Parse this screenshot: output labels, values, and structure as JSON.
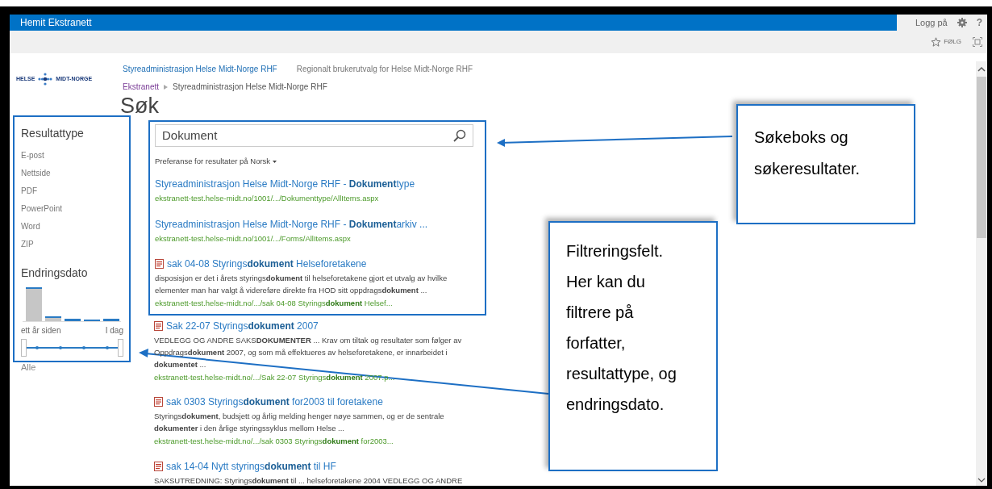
{
  "suite_bar": {
    "title": "Hemit Ekstranett",
    "sign_in": "Logg på",
    "help": "?"
  },
  "ribbon": {
    "follow": "FØLG"
  },
  "header": {
    "logo_left": "HELSE",
    "logo_right": "MIDT-NORGE",
    "top_links": [
      {
        "label": "Styreadministrasjon Helse Midt-Norge RHF",
        "selected": true
      },
      {
        "label": "Regionalt brukerutvalg for Helse Midt-Norge RHF",
        "selected": false
      }
    ],
    "breadcrumb": [
      "Ekstranett",
      "Styreadministrasjon Helse Midt-Norge RHF"
    ],
    "page_title": "Søk"
  },
  "result_type": {
    "title": "Resultattype",
    "items": [
      "E-post",
      "Nettside",
      "PDF",
      "PowerPoint",
      "Word",
      "ZIP"
    ]
  },
  "modified_date": {
    "title": "Endringsdato",
    "from_label": "ett år siden",
    "to_label": "I dag",
    "reset": "Alle"
  },
  "search": {
    "value": "Dokument",
    "language_pref": "Preferanse for resultater på Norsk"
  },
  "results": [
    {
      "kind": "page",
      "title": "Styreadministrasjon Helse Midt-Norge RHF - **Dokument**type",
      "url": "ekstranett-test.helse-midt.no/1001/.../Dokumenttype/AllItems.aspx"
    },
    {
      "kind": "page",
      "title": "Styreadministrasjon Helse Midt-Norge RHF - **Dokument**arkiv ...",
      "url": "ekstranett-test.helse-midt.no/1001/.../Forms/AllItems.aspx"
    },
    {
      "kind": "document",
      "title": "sak 04-08 Styrings**dokument** Helseforetakene",
      "snippet": "disposisjon er det i årets styrings**dokument** til helseforetakene gjort et utvalg av hvilke elementer man har valgt å videreføre direkte fra HOD sitt oppdrags**dokument** ...",
      "url": "ekstranett-test.helse-midt.no/.../sak 04-08 Styrings**dokument** Helsef..."
    },
    {
      "kind": "document",
      "title": "Sak 22-07 Styrings**dokument** 2007",
      "snippet": "VEDLEGG OG ANDRE SAKS**DOKUMENTER** ... Krav om tiltak og resultater som følger av Oppdrags**dokument** 2007, og som må effektueres av helseforetakene, er innarbeidet i **dokumentet** ...",
      "url": "ekstranett-test.helse-midt.no/.../Sak 22-07 Styrings**dokument** 2007.p..."
    },
    {
      "kind": "document",
      "title": "sak 0303 Styrings**dokument** for2003 til foretakene",
      "snippet": "Styrings**dokument**, budsjett og årlig melding henger nøye sammen, og er de sentrale **dokumenter** i den årlige styringssyklus mellom Helse ...",
      "url": "ekstranett-test.helse-midt.no/.../sak 0303 Styrings**dokument** for2003..."
    },
    {
      "kind": "document",
      "title": "sak 14-04 Nytt styrings**dokument** til HF",
      "snippet": "SAKSUTREDNING: Styrings**dokument** til ... helseforetakene 2004 VEDLEGG OG ANDRE"
    }
  ],
  "callouts": [
    {
      "text": "Søkeboks og søkeresultater."
    },
    {
      "text": "Filtreringsfelt. Her kan du filtrere på forfatter, resultattype, og endringsdato."
    }
  ]
}
